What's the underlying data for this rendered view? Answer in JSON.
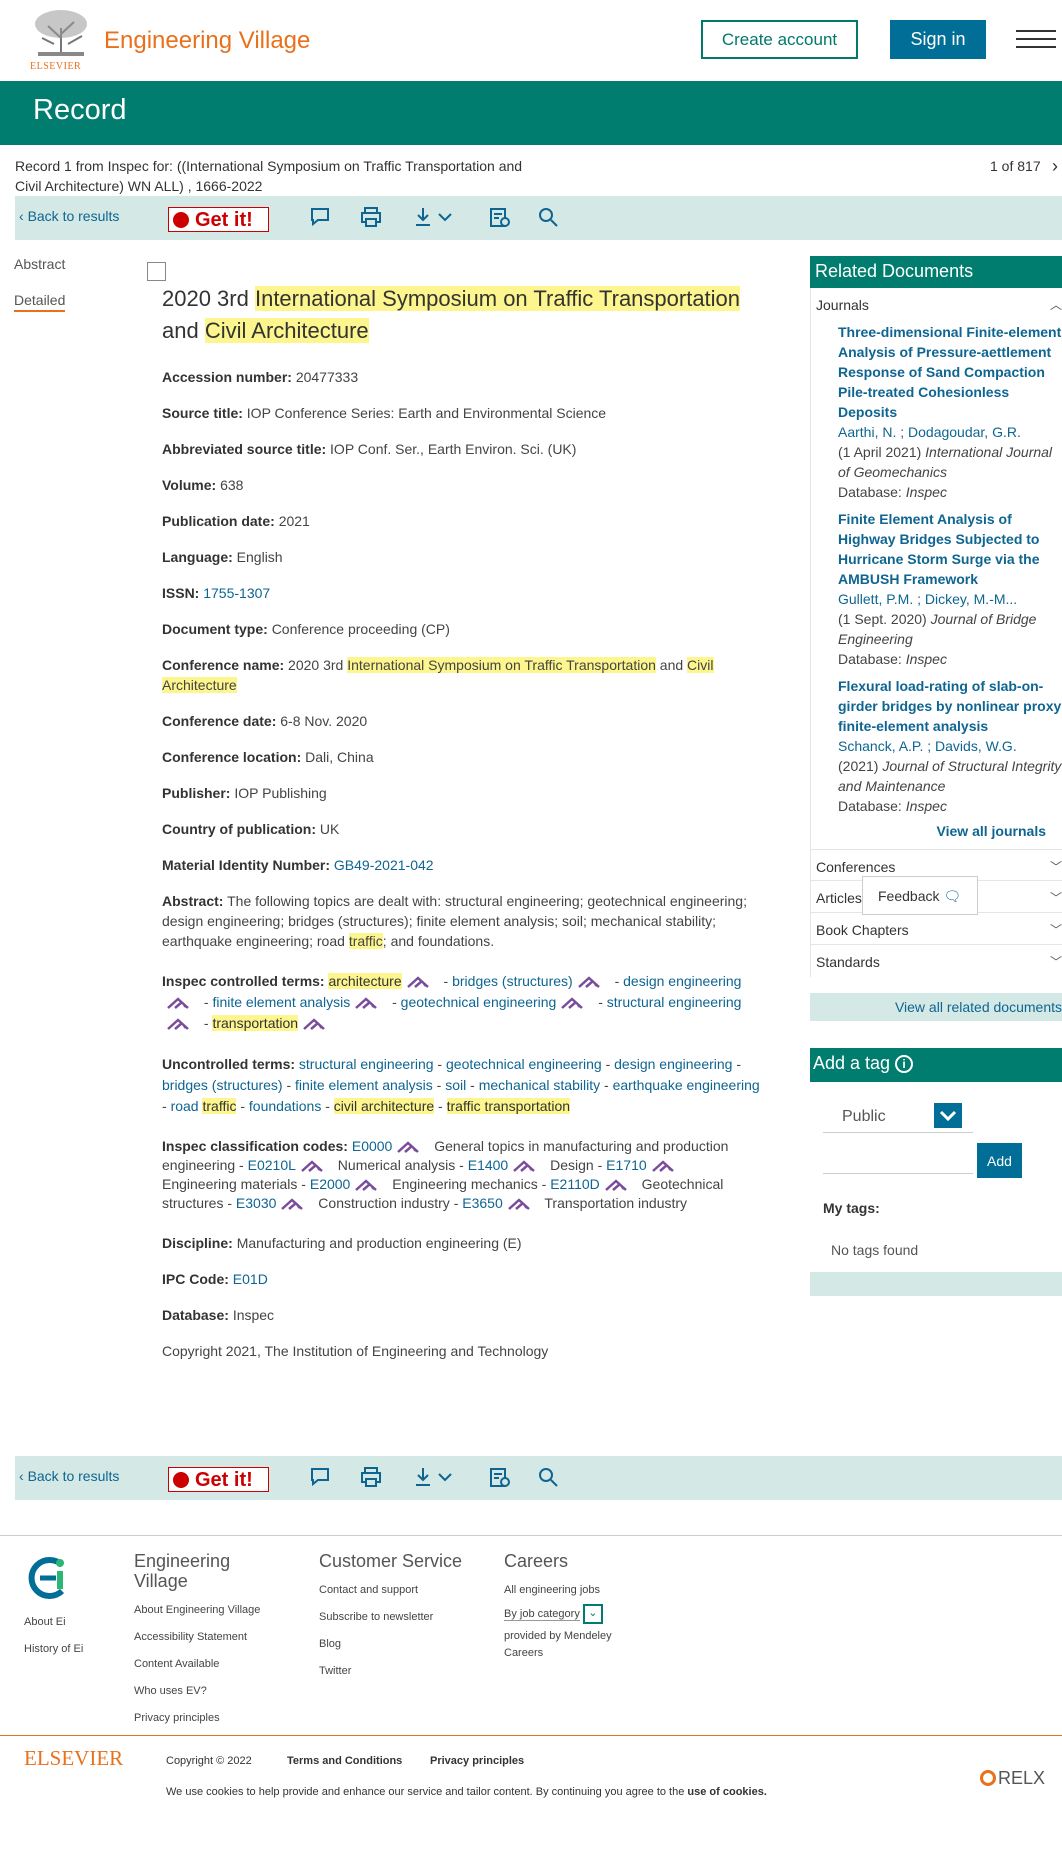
{
  "header": {
    "brand_name": "Engineering Village",
    "publisher_logo_text": "ELSEVIER",
    "create_account_label": "Create account",
    "sign_in_label": "Sign in"
  },
  "page_title": "Record",
  "record_info": {
    "source_line": "Record 1 from Inspec for: ((International Symposium on Traffic Transportation and Civil Architecture) WN ALL) , 1666-2022",
    "count": "1 of 817"
  },
  "toolbar": {
    "back_label": "Back to results",
    "getit_label": "Get it!"
  },
  "left_nav": {
    "abstract_label": "Abstract",
    "detailed_label": "Detailed"
  },
  "record": {
    "title_pre": "2020 3rd ",
    "title_hl1": "International Symposium on Traffic Transportation",
    "title_mid": " and ",
    "title_hl2": "Civil Architecture",
    "fields": [
      {
        "label": "Accession number:",
        "value": "20477333"
      },
      {
        "label": "Source title:",
        "value": "IOP Conference Series: Earth and Environmental Science"
      },
      {
        "label": "Abbreviated source title:",
        "value": "IOP Conf. Ser., Earth Environ. Sci. (UK)"
      },
      {
        "label": "Volume:",
        "value": "638"
      },
      {
        "label": "Publication date:",
        "value": "2021"
      },
      {
        "label": "Language:",
        "value": "English"
      }
    ],
    "issn_label": "ISSN:",
    "issn_value": "1755-1307",
    "doc_type_label": "Document type:",
    "doc_type_value": "Conference proceeding (CP)",
    "conf_name_label": "Conference name:",
    "conf_name_pre": "2020 3rd ",
    "conf_name_hl1": "International Symposium on Traffic Transportation",
    "conf_name_mid": " and ",
    "conf_name_hl2": "Civil Architecture",
    "fields2": [
      {
        "label": "Conference date:",
        "value": "6-8 Nov. 2020"
      },
      {
        "label": "Conference location:",
        "value": "Dali, China"
      },
      {
        "label": "Publisher:",
        "value": "IOP Publishing"
      },
      {
        "label": "Country of publication:",
        "value": "UK"
      }
    ],
    "material_label": "Material Identity Number:",
    "material_value": "GB49-2021-042",
    "abstract_label": "Abstract:",
    "abstract_pre": "The following topics are dealt with: structural engineering; geotechnical engineering; design engineering; bridges (structures); finite element analysis; soil; mechanical stability; earthquake engineering; road ",
    "abstract_hl": "traffic",
    "abstract_post": "; and foundations.",
    "controlled_label": "Inspec controlled terms:",
    "controlled_terms": {
      "t1": "architecture",
      "t2": "bridges (structures)",
      "t3": "design engineering",
      "t4": "finite element analysis",
      "t5": "geotechnical engineering",
      "t6": "structural engineering",
      "t7": "transportation"
    },
    "uncontrolled_label": "Uncontrolled terms:",
    "uncontrolled_terms": {
      "u1": "structural engineering",
      "u2": "geotechnical engineering",
      "u3": "design engineering",
      "u4": "bridges (structures)",
      "u5": "finite element analysis",
      "u6": "soil",
      "u7": "mechanical stability",
      "u8": "earthquake engineering",
      "u9a": "road ",
      "u9b": "traffic",
      "u10": "foundations",
      "u11": "civil architecture",
      "u12": "traffic transportation"
    },
    "classification_label": "Inspec classification codes:",
    "classification": {
      "c1": "E0000",
      "d1": "General topics in manufacturing and production engineering",
      "c2": "E0210L",
      "d2": "Numerical analysis",
      "c3": "E1400",
      "d3": "Design",
      "c4": "E1710",
      "d4": "Engineering materials",
      "c5": "E2000",
      "d5": "Engineering mechanics",
      "c6": "E2110D",
      "d6": "Geotechnical structures",
      "c7": "E3030",
      "d7": "Construction industry",
      "c8": "E3650",
      "d8": "Transportation industry"
    },
    "discipline_label": "Discipline:",
    "discipline_value": "Manufacturing and production engineering (E)",
    "ipc_label": "IPC Code:",
    "ipc_value": "E01D",
    "database_label": "Database:",
    "database_value": "Inspec",
    "copyright": "Copyright 2021, The Institution of Engineering and Technology"
  },
  "related": {
    "heading": "Related Documents",
    "journals_label": "Journals",
    "items": [
      {
        "title": "Three-dimensional Finite-element Analysis of Pressure-aettlement Response of Sand Compaction Pile-treated Cohesionless Deposits",
        "authors": "Aarthi, N. ; Dodagoudar, G.R.",
        "date": "(1 April 2021)",
        "journal": "International Journal of Geomechanics",
        "db_label": "Database:",
        "db": "Inspec"
      },
      {
        "title": "Finite Element Analysis of Highway Bridges Subjected to Hurricane Storm Surge via the AMBUSH Framework",
        "authors": "Gullett, P.M. ; Dickey, M.-M...",
        "date": "(1 Sept. 2020)",
        "journal": "Journal of Bridge Engineering",
        "db_label": "Database:",
        "db": "Inspec"
      },
      {
        "title": "Flexural load-rating of slab-on-girder bridges by nonlinear proxy finite-element analysis",
        "authors": "Schanck, A.P. ; Davids, W.G.",
        "date": "(2021)",
        "journal": "Journal of Structural Integrity and Maintenance",
        "db_label": "Database:",
        "db": "Inspec"
      }
    ],
    "view_all_journals": "View all journals",
    "conferences_label": "Conferences",
    "articles_label": "Articles",
    "book_chapters_label": "Book Chapters",
    "standards_label": "Standards",
    "view_all_related": "View all related documents"
  },
  "feedback_label": "Feedback",
  "tag": {
    "heading": "Add a tag",
    "visibility": "Public",
    "add_label": "Add",
    "my_tags_label": "My tags:",
    "no_tags": "No tags found"
  },
  "footer": {
    "about_ei": "About Ei",
    "history_ei": "History of Ei",
    "ev_heading": "Engineering Village",
    "ev_links": [
      "About Engineering Village",
      "Accessibility Statement",
      "Content Available",
      "Who uses EV?",
      "Privacy principles"
    ],
    "cs_heading": "Customer Service",
    "cs_links": [
      "Contact and support",
      "Subscribe to newsletter",
      "Blog",
      "Twitter"
    ],
    "careers_heading": "Careers",
    "careers_all": "All engineering jobs",
    "careers_by_category": "By job category",
    "careers_provided": "provided by Mendeley Careers",
    "elsevier": "ELSEVIER",
    "copyright": "Copyright © 2022",
    "terms": "Terms and Conditions",
    "privacy": "Privacy principles",
    "cookie_pre": "We use cookies to help provide and enhance our service and tailor content. By continuing you agree to the ",
    "cookie_link": "use of cookies.",
    "relx": "RELX"
  },
  "colors": {
    "teal": "#007d6e",
    "blue_button": "#006e96",
    "brand_orange": "#e9711c",
    "highlight": "#fdf58e",
    "link": "#0e6591",
    "toolbar_bg": "#d4e8e5"
  }
}
